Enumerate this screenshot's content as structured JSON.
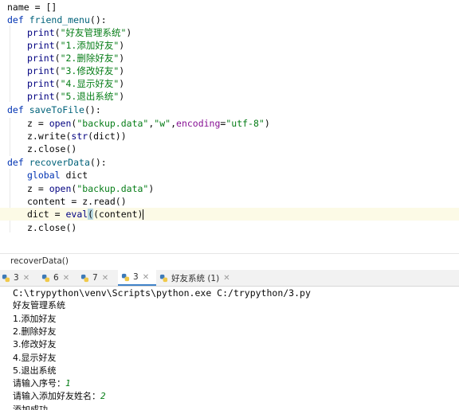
{
  "editor": {
    "lines": {
      "l1": "name = []",
      "l2_kw": "def",
      "l2_fn": "friend_menu",
      "l2_rest": "():",
      "l3_fn": "print",
      "l3_str": "\"好友管理系统\"",
      "l4_str": "\"1.添加好友\"",
      "l5_str": "\"2.删除好友\"",
      "l6_str": "\"3.修改好友\"",
      "l7_str": "\"4.显示好友\"",
      "l8_str": "\"5.退出系统\"",
      "l9_fn": "saveToFile",
      "l10_a": "z = ",
      "l10_fn": "open",
      "l10_s1": "\"backup.data\"",
      "l10_s2": "\"w\"",
      "l10_p": "encoding",
      "l10_s3": "\"utf-8\"",
      "l11_a": "z.write(",
      "l11_b": "str",
      "l11_c": "(dict))",
      "l12": "z.close()",
      "l13_fn": "recoverData",
      "l14_kw": "global",
      "l14_rest": " dict",
      "l15_s": "\"backup.data\"",
      "l16": "content = z.read()",
      "l17_a": "dict = ",
      "l17_fn": "eval",
      "l17_b": "(content)",
      "l18": "z.close()",
      "open_paren": "(",
      "close_paren": ")",
      "comma": ",",
      "eq": "="
    }
  },
  "breadcrumb": "recoverData()",
  "tabs": [
    {
      "label": "3"
    },
    {
      "label": "6"
    },
    {
      "label": "7"
    },
    {
      "label": "3"
    },
    {
      "label": "好友系统 (1)"
    }
  ],
  "console": {
    "command": "C:\\trypython\\venv\\Scripts\\python.exe C:/trypython/3.py",
    "lines": [
      "好友管理系统",
      "1.添加好友",
      "2.删除好友",
      "3.修改好友",
      "4.显示好友",
      "5.退出系统"
    ],
    "prompt1": "请输入序号：",
    "input1": "1",
    "prompt2": "请输入添加好友姓名：",
    "input2": "2",
    "last": "添加成功"
  },
  "colors": {
    "keyword": "#0033b3",
    "string": "#067d17",
    "active_tab": "#4083c9",
    "input": "#087e18"
  }
}
